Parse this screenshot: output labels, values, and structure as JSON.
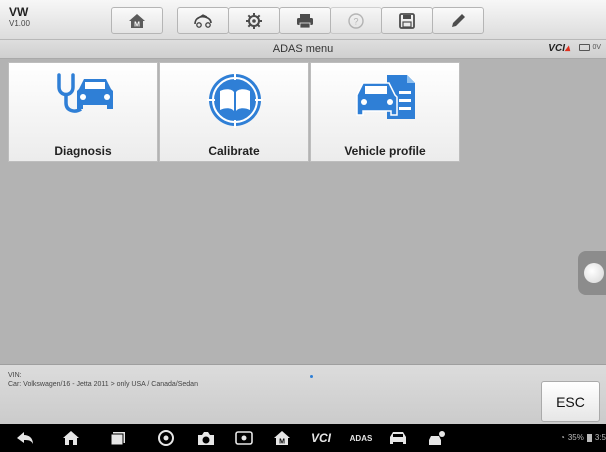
{
  "header": {
    "brand": "VW",
    "version": "V1.00",
    "toolbar": [
      {
        "name": "home-button",
        "icon": "home-icon"
      },
      {
        "name": "vehicle-swap-button",
        "icon": "car-swap-icon"
      },
      {
        "name": "settings-button",
        "icon": "gear-icon"
      },
      {
        "name": "print-button",
        "icon": "printer-icon"
      },
      {
        "name": "help-button",
        "icon": "help-icon"
      },
      {
        "name": "save-button",
        "icon": "save-icon"
      },
      {
        "name": "data-logging-button",
        "icon": "pen-icon"
      }
    ]
  },
  "titlebar": {
    "title": "ADAS menu",
    "vci": "VCI",
    "battery": "0V"
  },
  "menu": {
    "tiles": [
      {
        "label": "Diagnosis",
        "icon": "stethoscope-car-icon"
      },
      {
        "label": "Calibrate",
        "icon": "calibrate-book-icon"
      },
      {
        "label": "Vehicle profile",
        "icon": "vehicle-profile-icon"
      }
    ]
  },
  "footer": {
    "vin_label": "VIN:",
    "car_info": "Car: Volkswagen/16 - Jetta 2011 > only USA / Canada/Sedan",
    "esc_label": "ESC"
  },
  "system_bar": {
    "battery_percent": "35%",
    "time": "3:5",
    "vci_label": "VCI",
    "adas_label": "ADAS",
    "icons": [
      "back-icon",
      "home-icon",
      "recent-apps-icon",
      "browser-icon",
      "camera-icon",
      "screen-record-icon",
      "maxisys-home-icon",
      "vci-icon",
      "adas-icon",
      "car-icon",
      "remote-icon"
    ]
  },
  "colors": {
    "accent_blue": "#2f7fd6",
    "content_bg": "#b3b3b3",
    "vci_red": "#e0301e"
  }
}
